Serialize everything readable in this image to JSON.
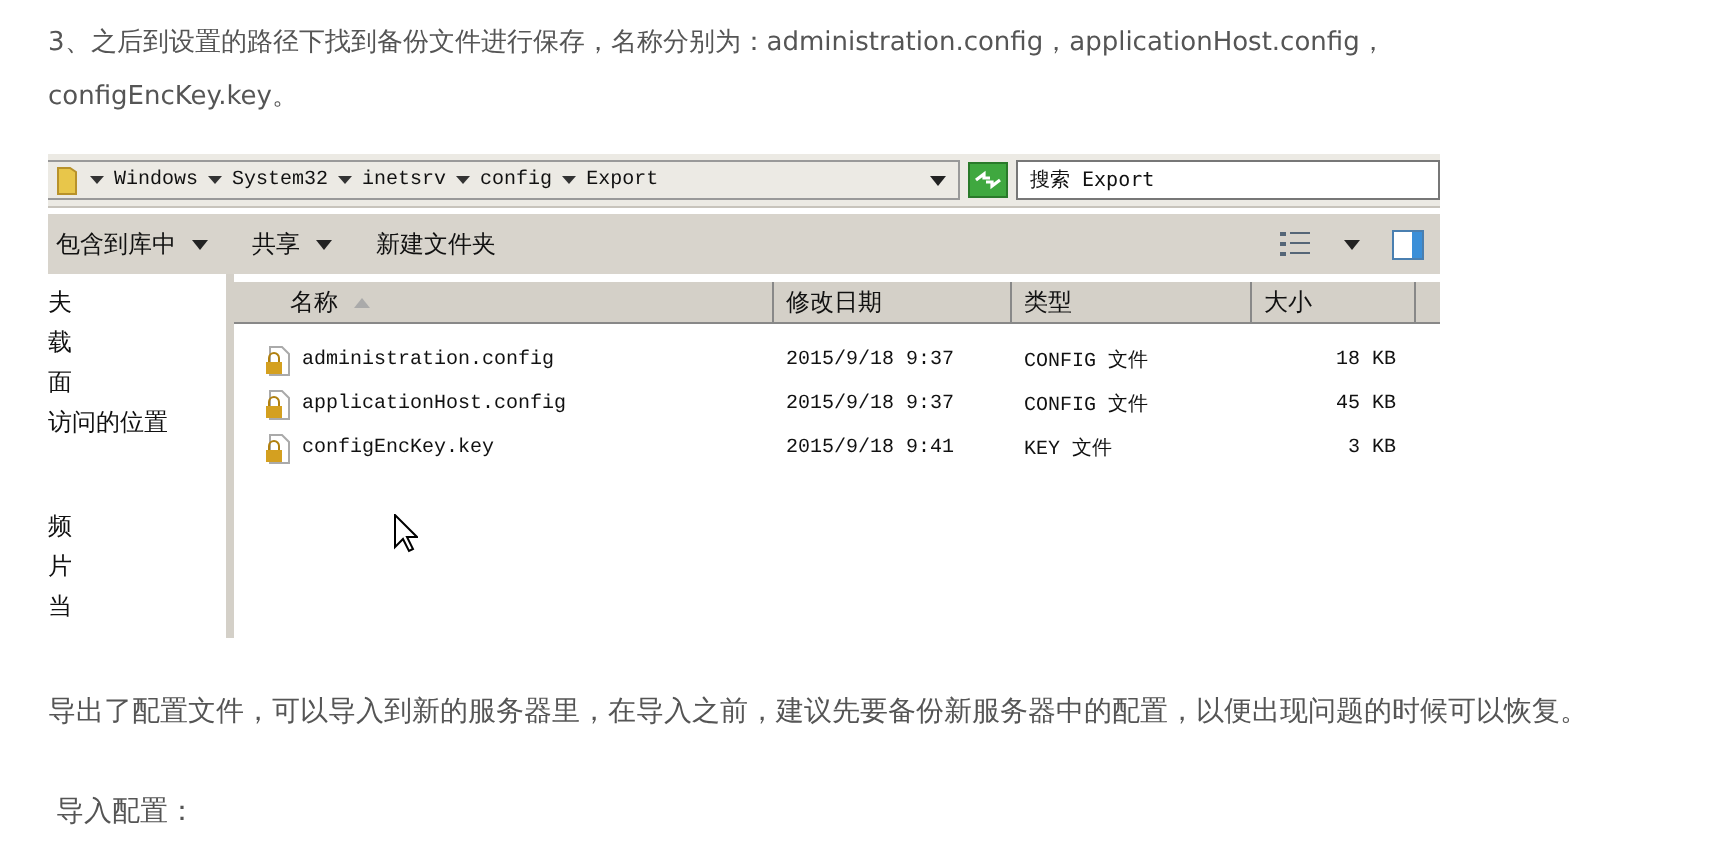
{
  "intro": "3、之后到设置的路径下找到备份文件进行保存，名称分别为：administration.config，applicationHost.config，configEncKey.key。",
  "explorer": {
    "path": [
      "Windows",
      "System32",
      "inetsrv",
      "config",
      "Export"
    ],
    "search": {
      "placeholder": "搜索 Export"
    },
    "toolbar": [
      "包含到库中",
      "共享",
      "新建文件夹"
    ],
    "sidebar": [
      "夫",
      "载",
      "面",
      "访问的位置",
      "频",
      "片",
      "当"
    ],
    "columns": [
      {
        "label": "名称",
        "sorted": true
      },
      {
        "label": "修改日期",
        "sorted": false
      },
      {
        "label": "类型",
        "sorted": false
      },
      {
        "label": "大小",
        "sorted": false
      }
    ],
    "rows": [
      {
        "name": "administration.config",
        "date": "2015/9/18 9:37",
        "type": "CONFIG 文件",
        "size": "18 KB"
      },
      {
        "name": "applicationHost.config",
        "date": "2015/9/18 9:37",
        "type": "CONFIG 文件",
        "size": "45 KB"
      },
      {
        "name": "configEncKey.key",
        "date": "2015/9/18 9:41",
        "type": "KEY 文件",
        "size": "3 KB"
      }
    ]
  },
  "after": "导出了配置文件，可以导入到新的服务器里，在导入之前，建议先要备份新服务器中的配置，以便出现问题的时候可以恢复。",
  "heading": "导入配置："
}
